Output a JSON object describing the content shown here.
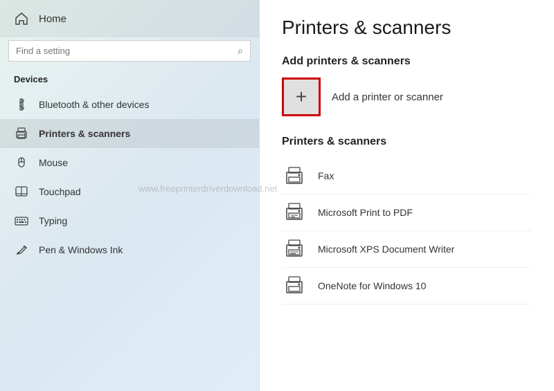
{
  "sidebar": {
    "home_label": "Home",
    "search_placeholder": "Find a setting",
    "section_title": "Devices",
    "nav_items": [
      {
        "id": "bluetooth",
        "label": "Bluetooth & other devices",
        "icon": "bluetooth"
      },
      {
        "id": "printers",
        "label": "Printers & scanners",
        "icon": "printer",
        "active": true
      },
      {
        "id": "mouse",
        "label": "Mouse",
        "icon": "mouse"
      },
      {
        "id": "touchpad",
        "label": "Touchpad",
        "icon": "touchpad"
      },
      {
        "id": "typing",
        "label": "Typing",
        "icon": "keyboard"
      },
      {
        "id": "pen",
        "label": "Pen & Windows Ink",
        "icon": "pen"
      }
    ]
  },
  "main": {
    "page_title": "Printers & scanners",
    "add_section_title": "Add printers & scanners",
    "add_button_label": "+",
    "add_printer_label": "Add a printer or scanner",
    "printers_section_title": "Printers & scanners",
    "printers": [
      {
        "id": "fax",
        "name": "Fax"
      },
      {
        "id": "pdf",
        "name": "Microsoft Print to PDF"
      },
      {
        "id": "xps",
        "name": "Microsoft XPS Document Writer"
      },
      {
        "id": "onenote",
        "name": "OneNote for Windows 10"
      }
    ]
  },
  "watermark": "www.freeprinterdriverdownload.net"
}
